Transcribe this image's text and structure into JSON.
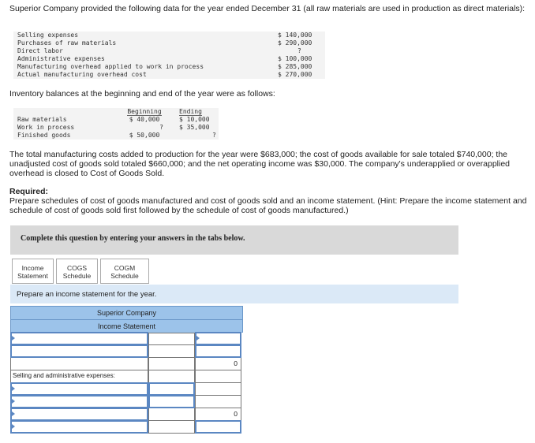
{
  "intro": "Superior Company provided the following data for the year ended December 31 (all raw materials are used in production as direct materials):",
  "data_rows": [
    {
      "label": "Selling expenses",
      "value": "$ 140,000"
    },
    {
      "label": "Purchases of raw materials",
      "value": "$ 290,000"
    },
    {
      "label": "Direct labor",
      "value": "?"
    },
    {
      "label": "Administrative expenses",
      "value": "$ 100,000"
    },
    {
      "label": "Manufacturing overhead applied to work in process",
      "value": "$ 285,000"
    },
    {
      "label": "Actual manufacturing overhead cost",
      "value": "$ 270,000"
    }
  ],
  "inventory_intro": "Inventory balances at the beginning and end of the year were as follows:",
  "inventory": {
    "col_beginning": "Beginning",
    "col_ending": "Ending",
    "rows": [
      {
        "label": "Raw materials",
        "beginning": "$ 40,000",
        "ending": "$ 10,000"
      },
      {
        "label": "Work in process",
        "beginning": "?",
        "ending": "$ 35,000"
      },
      {
        "label": "Finished goods",
        "beginning": "$ 50,000",
        "ending": "?"
      }
    ]
  },
  "total_para": "The total manufacturing costs added to production for the year were $683,000; the cost of goods available for sale totaled $740,000; the unadjusted cost of goods sold totaled $660,000; and the net operating income was $30,000. The company's underapplied or overapplied overhead is closed to Cost of Goods Sold.",
  "required": {
    "title": "Required:",
    "text": "Prepare schedules of cost of goods manufactured and cost of goods sold and an income statement. (Hint: Prepare the income statement and schedule of cost of goods sold first followed by the schedule of cost of goods manufactured.)"
  },
  "complete_box": "Complete this question by entering your answers in the tabs below.",
  "tabs": [
    {
      "line1": "Income",
      "line2": "Statement"
    },
    {
      "line1": "COGS",
      "line2": "Schedule"
    },
    {
      "line1": "COGM",
      "line2": "Schedule"
    }
  ],
  "prompt": "Prepare an income statement for the year.",
  "statement": {
    "company": "Superior Company",
    "title": "Income Statement",
    "selling_admin_label": "Selling and administrative expenses:",
    "zero1": "0",
    "zero2": "0"
  },
  "colors": {
    "header_blue": "#9cc3ea",
    "input_border": "#5b87c2",
    "prompt_bg": "#dbe9f7",
    "complete_bg": "#d9d9d9"
  }
}
